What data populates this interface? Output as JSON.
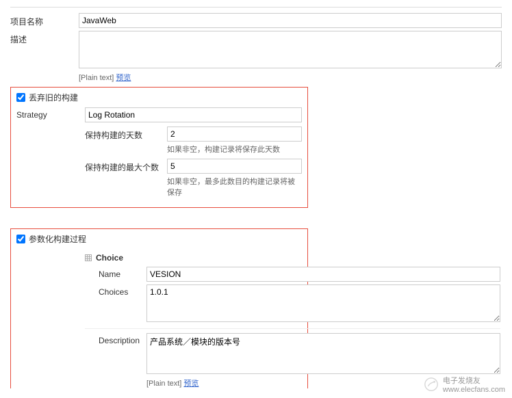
{
  "project": {
    "name_label": "项目名称",
    "name_value": "JavaWeb",
    "desc_label": "描述",
    "desc_value": "",
    "plain_text": "[Plain text]",
    "preview_link": "预览"
  },
  "discard": {
    "checkbox_label": "丢弃旧的构建",
    "strategy_label": "Strategy",
    "strategy_value": "Log Rotation",
    "days_label": "保持构建的天数",
    "days_value": "2",
    "days_help": "如果非空，构建记录将保存此天数",
    "max_label": "保持构建的最大个数",
    "max_value": "5",
    "max_help": "如果非空，最多此数目的构建记录将被保存"
  },
  "param": {
    "checkbox_label": "参数化构建过程",
    "choice_title": "Choice",
    "name_label": "Name",
    "name_value": "VESION",
    "choices_label": "Choices",
    "choices_value": "1.0.1",
    "desc_label": "Description",
    "desc_value": "产品系统／模块的版本号",
    "plain_text": "[Plain text]",
    "preview_link": "预览"
  },
  "watermark": {
    "brand": "电子发烧友",
    "url": "www.elecfans.com"
  }
}
